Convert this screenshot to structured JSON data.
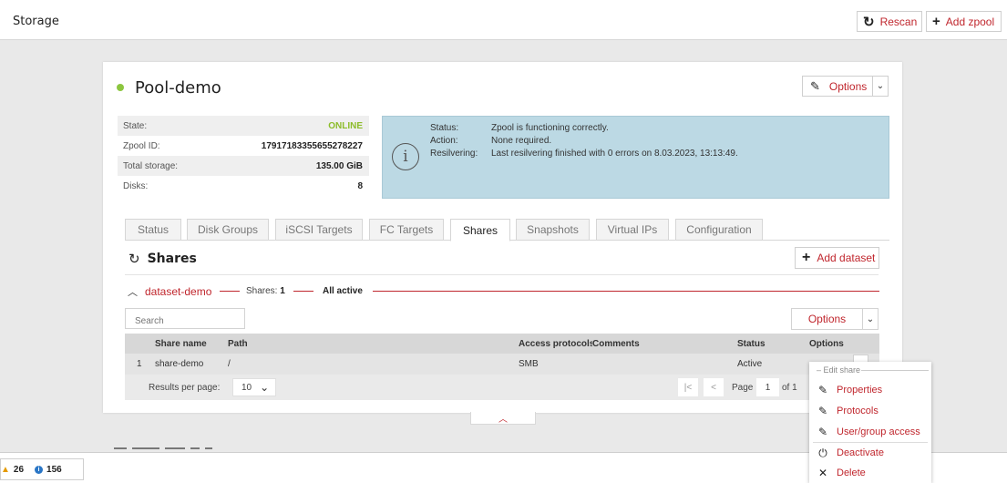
{
  "header": {
    "title": "Storage",
    "rescan_label": "Rescan",
    "add_zpool_label": "Add zpool"
  },
  "pool": {
    "name": "Pool-demo",
    "options_label": "Options",
    "props": [
      {
        "key": "State:",
        "value": "ONLINE"
      },
      {
        "key": "Zpool ID:",
        "value": "17917183355655278227"
      },
      {
        "key": "Total storage:",
        "value": "135.00 GiB"
      },
      {
        "key": "Disks:",
        "value": "8"
      }
    ],
    "info": {
      "status_label": "Status:",
      "status_value": "Zpool is functioning correctly.",
      "action_label": "Action:",
      "action_value": "None required.",
      "resilvering_label": "Resilvering:",
      "resilvering_value": "Last resilvering finished with 0 errors on 8.03.2023, 13:13:49."
    },
    "tabs": [
      "Status",
      "Disk Groups",
      "iSCSI Targets",
      "FC Targets",
      "Shares",
      "Snapshots",
      "Virtual IPs",
      "Configuration"
    ],
    "active_tab": "Shares"
  },
  "shares": {
    "title": "Shares",
    "add_dataset_label": "Add dataset",
    "dataset": {
      "name": "dataset-demo",
      "shares_label": "Shares:",
      "shares_count": "1",
      "status": "All active"
    },
    "search_placeholder": "Search",
    "options_label": "Options",
    "columns": [
      "Share name",
      "Path",
      "Access protocols",
      "Comments",
      "Status",
      "Options"
    ],
    "rows": [
      {
        "index": "1",
        "name": "share-demo",
        "path": "/",
        "protocol": "SMB",
        "comments": "",
        "status": "Active"
      }
    ],
    "pagination": {
      "results_per_page_label": "Results per page:",
      "per_page": "10",
      "page_label": "Page",
      "page": "1",
      "of_label": "of 1"
    }
  },
  "context_menu": {
    "section_label": "Edit share",
    "items": [
      {
        "label": "Properties",
        "icon": "edit-icon"
      },
      {
        "label": "Protocols",
        "icon": "edit-icon"
      },
      {
        "label": "User/group access",
        "icon": "edit-icon"
      },
      {
        "label": "Deactivate",
        "icon": "plug-icon"
      },
      {
        "label": "Delete",
        "icon": "close-icon"
      }
    ]
  },
  "status_bar": {
    "warnings": "26",
    "infos": "156"
  },
  "colors": {
    "accent": "#c0262d",
    "online": "#8cbc2a",
    "info_box": "#bcd9e4"
  }
}
